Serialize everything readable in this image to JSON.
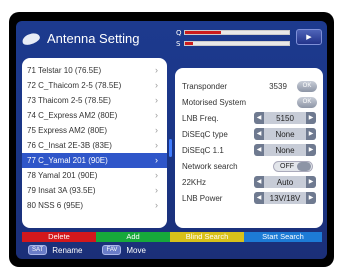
{
  "header": {
    "title": "Antenna Setting",
    "q_label": "Q",
    "s_label": "S",
    "q_level": 0.35,
    "s_level": 0.08,
    "menu_icon": "play-arrow-icon"
  },
  "satellites": [
    {
      "label": "71  Telstar 10 (76.5E)",
      "selected": false
    },
    {
      "label": "72  C_Thaicom 2-5 (78.5E)",
      "selected": false
    },
    {
      "label": "73  Thaicom 2-5 (78.5E)",
      "selected": false
    },
    {
      "label": "74  C_Express AM2 (80E)",
      "selected": false
    },
    {
      "label": "75  Express AM2 (80E)",
      "selected": false
    },
    {
      "label": "76  C_Insat 2E-3B (83E)",
      "selected": false
    },
    {
      "label": "77  C_Yamal 201 (90E)",
      "selected": true
    },
    {
      "label": "78  Yamal 201 (90E)",
      "selected": false
    },
    {
      "label": "79  Insat 3A (93.5E)",
      "selected": false
    },
    {
      "label": "80  NSS 6 (95E)",
      "selected": false
    }
  ],
  "panel": {
    "transponder_label": "Transponder",
    "transponder_value": "3539",
    "ok_label": "OK",
    "motorised_label": "Motorised System",
    "lnb_freq_label": "LNB Freq.",
    "lnb_freq_value": "5150",
    "diseqc_type_label": "DiSEqC type",
    "diseqc_type_value": "None",
    "diseqc11_label": "DiSEqC 1.1",
    "diseqc11_value": "None",
    "network_search_label": "Network search",
    "network_search_value": "OFF",
    "k22_label": "22KHz",
    "k22_value": "Auto",
    "lnb_power_label": "LNB Power",
    "lnb_power_value": "13V/18V"
  },
  "color_buttons": {
    "red": "Delete",
    "green": "Add",
    "yellow": "Blind Search",
    "blue": "Start Search"
  },
  "hints": {
    "sat_key": "SAT",
    "sat_text": "Rename",
    "fav_key": "FAV",
    "fav_text": "Move"
  }
}
